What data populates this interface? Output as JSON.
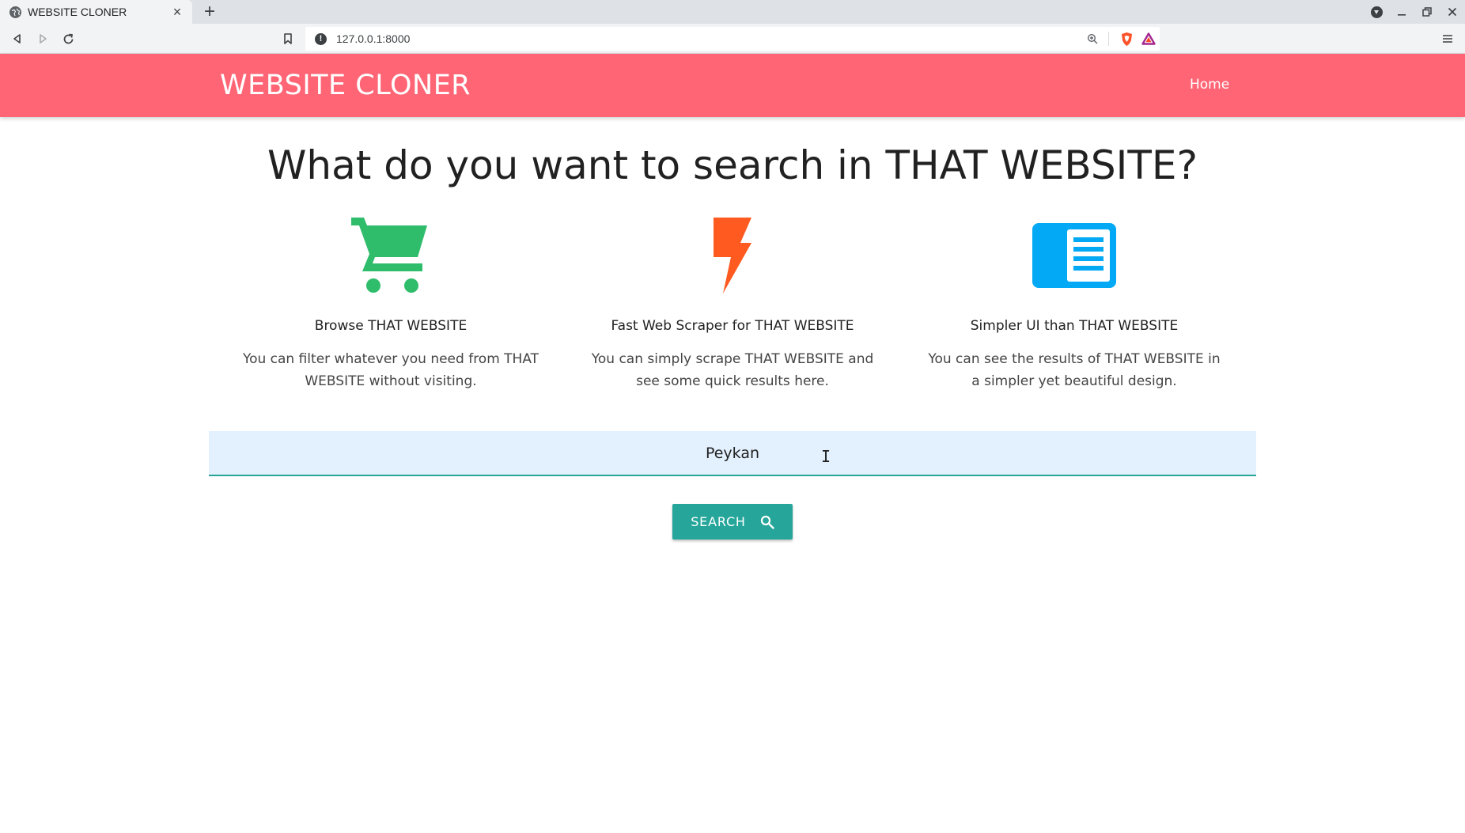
{
  "browser": {
    "tab": {
      "title": "WEBSITE CLONER",
      "close": "×"
    },
    "new_tab": "+",
    "url": "127.0.0.1:8000",
    "info_glyph": "!"
  },
  "navbar": {
    "brand": "WEBSITE CLONER",
    "home": "Home",
    "color": "#ff6575"
  },
  "headline": "What do you want to search in THAT WEBSITE?",
  "features": [
    {
      "icon": "shopping-cart-icon",
      "title": "Browse THAT WEBSITE",
      "text": "You can filter whatever you need from THAT WEBSITE without visiting.",
      "color": "#2fbd6c"
    },
    {
      "icon": "lightning-bolt-icon",
      "title": "Fast Web Scraper for THAT WEBSITE",
      "text": "You can simply scrape THAT WEBSITE and see some quick results here.",
      "color": "#ff5a1f"
    },
    {
      "icon": "document-layout-icon",
      "title": "Simpler UI than THAT WEBSITE",
      "text": "You can see the results of THAT WEBSITE in a simpler yet beautiful design.",
      "color": "#03a9f4"
    }
  ],
  "search": {
    "value": "Peykan",
    "button_label": "SEARCH",
    "accent": "#26a69a"
  }
}
